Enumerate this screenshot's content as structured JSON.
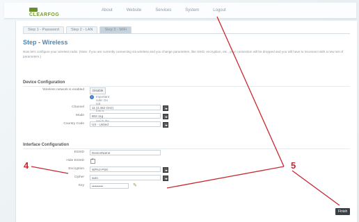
{
  "logo": {
    "text": "CLEARFOG"
  },
  "nav": [
    "About",
    "Website",
    "Services",
    "System",
    "Logout"
  ],
  "tabs": [
    {
      "label": "Step 1 - Password",
      "active": false
    },
    {
      "label": "Step 2 - LAN",
      "active": false
    },
    {
      "label": "Step 3 - WiFi",
      "active": true
    }
  ],
  "page_title": "Step - Wireless",
  "intro_text": "Now let's configure your wireless radio. (Note: if you are currently connecting via wireless and you change parameters, like SSID, encryption, etc., your connection will be dropped and you will have to reconnect with a new set of parameters.)",
  "device": {
    "heading": "Device Configuration",
    "enabled_label": "Wireless network is enabled",
    "enabled_button": "Disable",
    "info_note": "Important note: Do not disable if this is your only way to reach the router.",
    "channel_label": "Channel",
    "channel_value": "11 (2.462 GHz)",
    "mode_label": "Mode",
    "mode_value": "802.11g",
    "country_label": "Country Code",
    "country_value": "US - United"
  },
  "interface": {
    "heading": "Interface Configuration",
    "essid_label": "ESSID",
    "essid_value": "DeviceName",
    "hide_label": "Hide ESSID",
    "encryption_label": "Encryption",
    "encryption_value": "WPA2-PSK",
    "cipher_label": "Cipher",
    "cipher_value": "auto",
    "key_label": "Key",
    "key_value": "••••••••••"
  },
  "finish_label": "Finish",
  "callouts": {
    "left": "4",
    "right": "5"
  },
  "colors": {
    "annotation": "#c8272d",
    "accent": "#4e86b8"
  }
}
